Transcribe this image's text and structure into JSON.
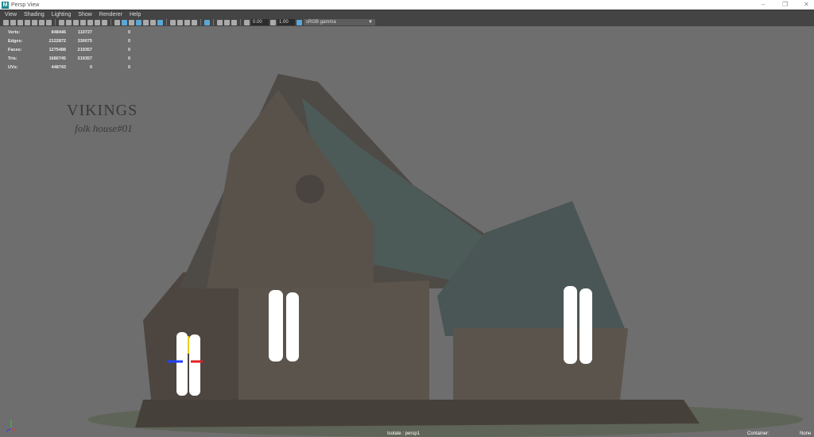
{
  "window": {
    "title": "Persp View",
    "app_icon": "M"
  },
  "menu": [
    "View",
    "Shading",
    "Lighting",
    "Show",
    "Renderer",
    "Help"
  ],
  "toolbar": {
    "exposure": "0.00",
    "gamma": "1.00",
    "color_space": "sRGB gamma"
  },
  "stats": [
    {
      "label": "Verts:",
      "a": "848446",
      "b": "110727",
      "c": "0"
    },
    {
      "label": "Edges:",
      "a": "2122872",
      "b": "330075",
      "c": "0"
    },
    {
      "label": "Faces:",
      "a": "1275488",
      "b": "219357",
      "c": "0"
    },
    {
      "label": "Tris:",
      "a": "1680745",
      "b": "219357",
      "c": "0"
    },
    {
      "label": "UVs:",
      "a": "448743",
      "b": "0",
      "c": "0"
    }
  ],
  "logo": {
    "title": "VIKINGS",
    "subtitle": "folk house#01"
  },
  "footer": {
    "isolate": "Isolate : persp1",
    "container_label": "Container:",
    "container_value": "None"
  }
}
